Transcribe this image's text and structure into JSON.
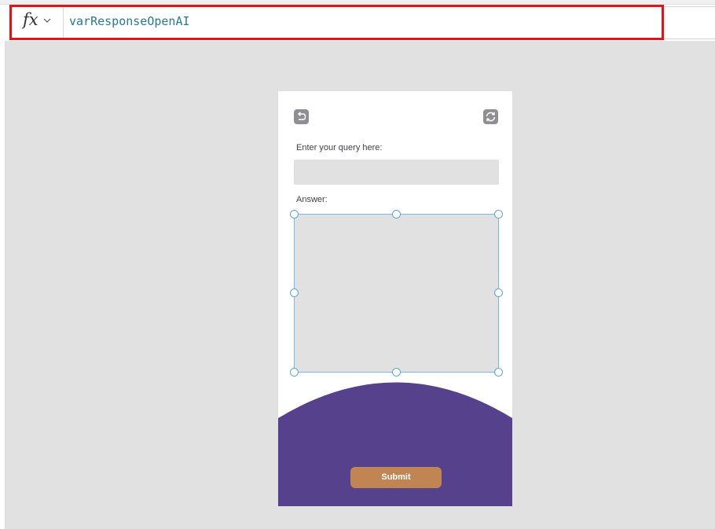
{
  "formula_bar": {
    "fx_label": "fx",
    "formula": "varResponseOpenAI"
  },
  "app": {
    "query_label": "Enter your query here:",
    "query_value": "",
    "answer_label": "Answer:",
    "answer_value": "",
    "submit_label": "Submit",
    "icons": {
      "back": "back-arrow-icon",
      "refresh": "refresh-icon"
    }
  },
  "colors": {
    "highlight": "#e0141b",
    "formula_text": "#2a7a8c",
    "footer_purple": "#55418c",
    "submit_button": "#c08553",
    "selection": "#7fb7df"
  }
}
